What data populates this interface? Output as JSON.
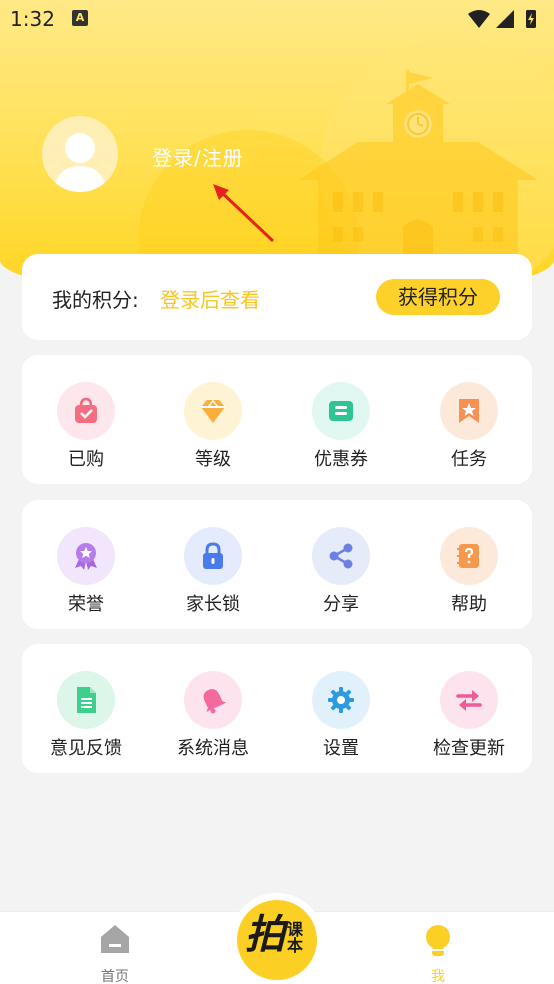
{
  "status_bar": {
    "time": "1:32",
    "notification_icon_letter": "A"
  },
  "profile": {
    "login_text": "登录/注册"
  },
  "points": {
    "label": "我的积分:",
    "value_text": "登录后查看",
    "earn_button": "获得积分"
  },
  "grid1": {
    "items": [
      {
        "label": "已购",
        "icon": "shopping-bag-icon"
      },
      {
        "label": "等级",
        "icon": "diamond-icon"
      },
      {
        "label": "优惠券",
        "icon": "coupon-icon"
      },
      {
        "label": "任务",
        "icon": "bookmark-star-icon"
      }
    ]
  },
  "grid2": {
    "items": [
      {
        "label": "荣誉",
        "icon": "medal-icon"
      },
      {
        "label": "家长锁",
        "icon": "lock-icon"
      },
      {
        "label": "分享",
        "icon": "share-icon"
      },
      {
        "label": "帮助",
        "icon": "help-book-icon"
      }
    ]
  },
  "grid3": {
    "items": [
      {
        "label": "意见反馈",
        "icon": "feedback-document-icon"
      },
      {
        "label": "系统消息",
        "icon": "bell-icon"
      },
      {
        "label": "设置",
        "icon": "gear-icon"
      },
      {
        "label": "检查更新",
        "icon": "refresh-arrows-icon"
      }
    ]
  },
  "bottom_nav": {
    "home_label": "首页",
    "center_logo_main": "拍",
    "center_logo_sub": "课本",
    "me_label": "我"
  },
  "colors": {
    "accent_yellow": "#fdd02a",
    "points_value": "#fcc41c",
    "active_tab": "#fccf24"
  }
}
